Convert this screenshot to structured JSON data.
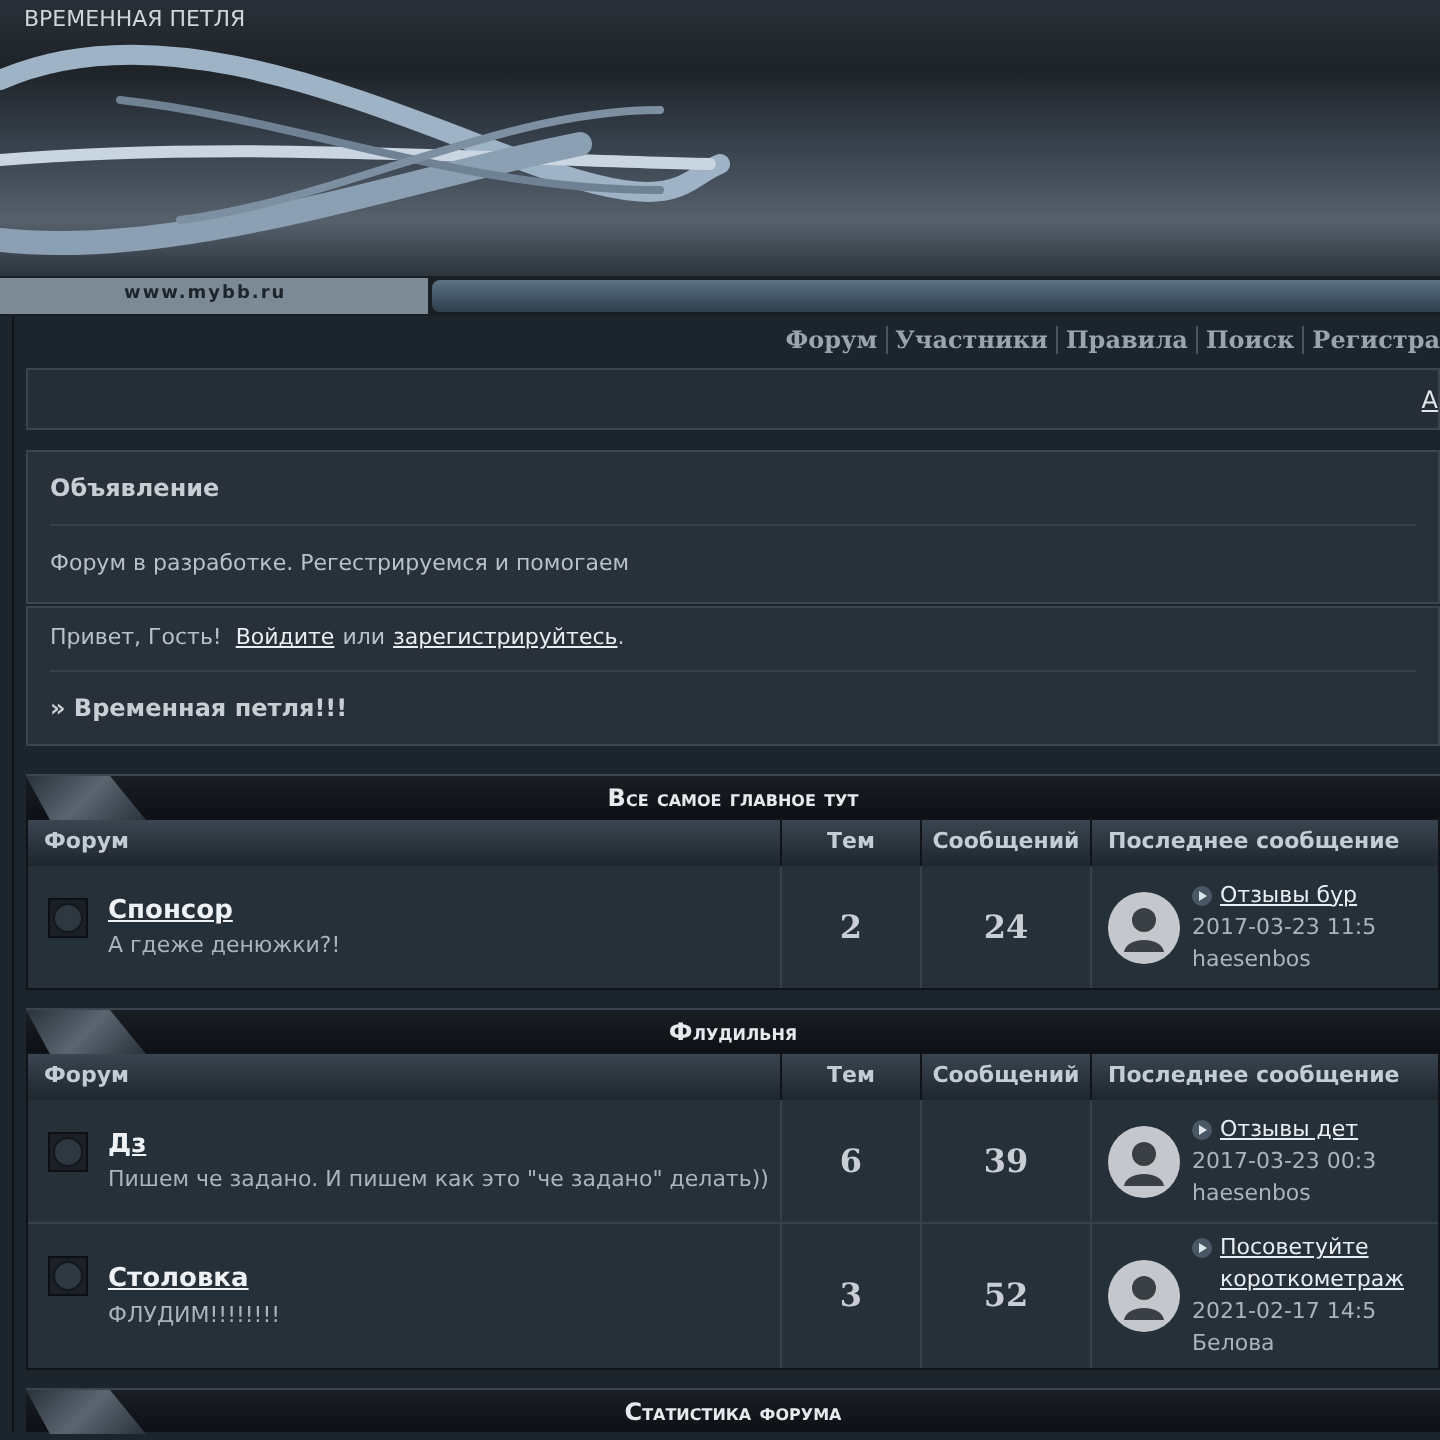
{
  "header": {
    "title": "ВРЕМЕННАЯ ПЕТЛЯ",
    "logo": "www.mybb.ru"
  },
  "nav": [
    "Форум",
    "Участники",
    "Правила",
    "Поиск",
    "Регистра"
  ],
  "top_box": {
    "link": "А"
  },
  "announcement": {
    "title": "Объявление",
    "text": "Форум в разработке. Регестрируемся и помогаем"
  },
  "welcome": {
    "greeting": "Привет, Гость!",
    "login": "Войдите",
    "or": "или",
    "register": "зарегистрируйтесь",
    "end": ".",
    "board_title": "» Временная петля!!!"
  },
  "categories": [
    {
      "title": "Все самое главное тут",
      "columns": [
        "Форум",
        "Тем",
        "Сообщений",
        "Последнее сообщение"
      ],
      "forums": [
        {
          "name": "Спонсор",
          "description": "А гдеже денюжки?!",
          "topics": "2",
          "posts": "24",
          "last_post": {
            "topic": "Отзывы бур",
            "date": "2017-03-23 11:5",
            "author": "haesenbos"
          }
        }
      ]
    },
    {
      "title": "Флудильня",
      "columns": [
        "Форум",
        "Тем",
        "Сообщений",
        "Последнее сообщение"
      ],
      "forums": [
        {
          "name": "Дз",
          "description": "Пишем че задано. И пишем как это \"че задано\" делать))",
          "topics": "6",
          "posts": "39",
          "last_post": {
            "topic": "Отзывы дет",
            "date": "2017-03-23 00:3",
            "author": "haesenbos"
          }
        },
        {
          "name": "Столовка",
          "description": "ФЛУДИМ!!!!!!!!",
          "topics": "3",
          "posts": "52",
          "last_post": {
            "topic": "Посоветуйте короткометраж",
            "date": "2021-02-17 14:5",
            "author": "Белова"
          }
        }
      ]
    },
    {
      "title": "Статистика форума"
    }
  ]
}
